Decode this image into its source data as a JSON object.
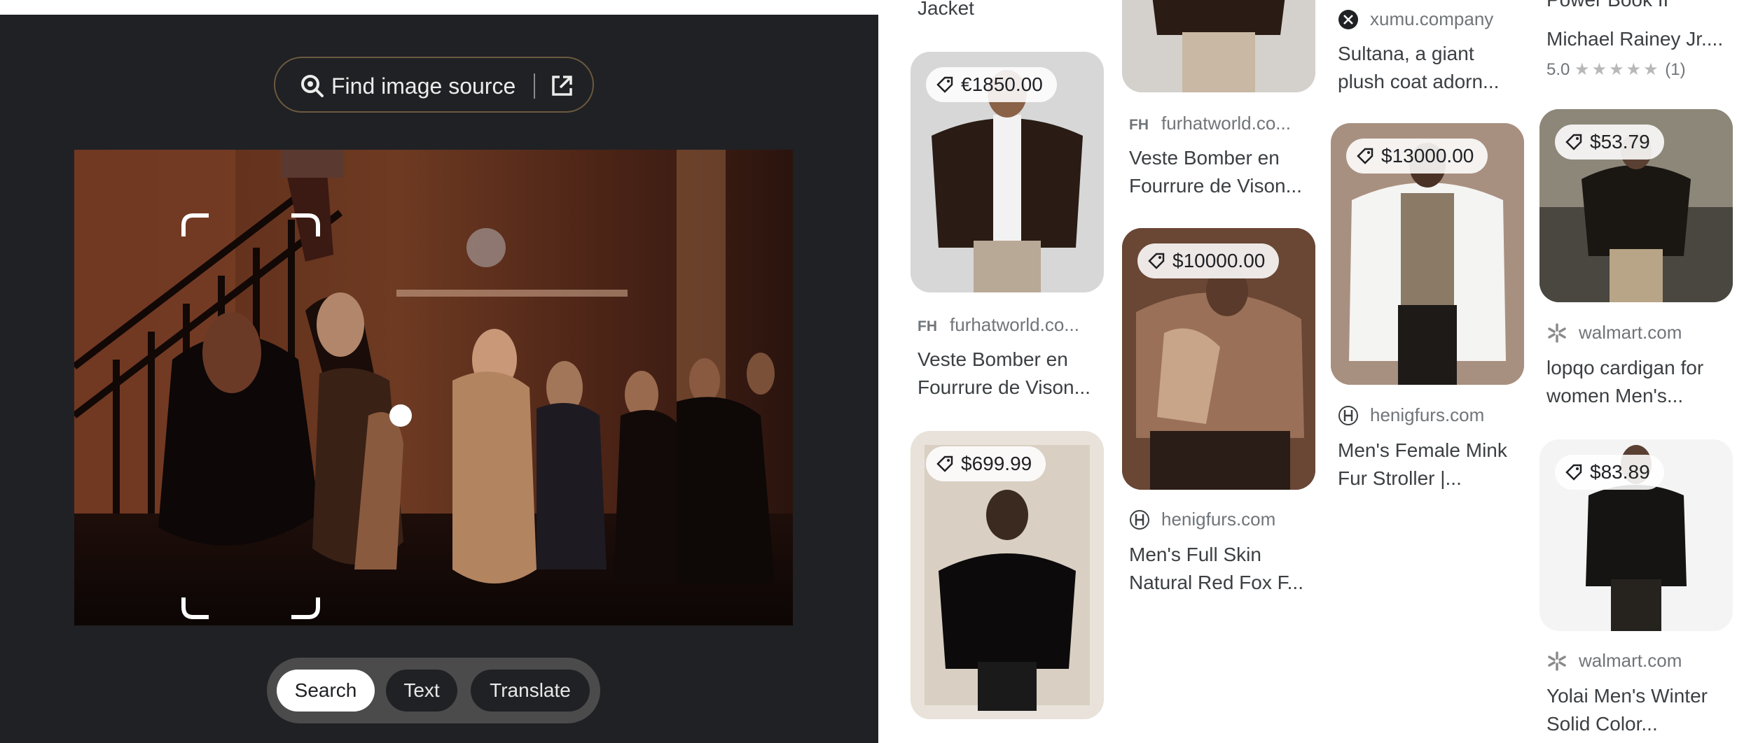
{
  "left_panel": {
    "find_source_label": "Find image source",
    "tabs": [
      "Search",
      "Text",
      "Translate"
    ],
    "active_tab": "Search"
  },
  "results": {
    "col1": [
      {
        "title_line2": "Jacket"
      },
      {
        "price": "€1850.00",
        "site": "furhatworld.co...",
        "title": [
          "Veste Bomber en",
          "Fourrure de Vison..."
        ]
      },
      {
        "price": "$699.99"
      }
    ],
    "col2": [
      {
        "site": "furhatworld.co...",
        "title": [
          "Veste Bomber en",
          "Fourrure de Vison..."
        ]
      },
      {
        "price": "$10000.00",
        "site": "henigfurs.com",
        "title": [
          "Men's Full Skin",
          "Natural Red Fox F..."
        ]
      }
    ],
    "col3": [
      {
        "site": "xumu.company",
        "title": [
          "Sultana, a giant",
          "plush coat adorn..."
        ]
      },
      {
        "price": "$13000.00",
        "site": "henigfurs.com",
        "title": [
          "Men's Female Mink",
          "Fur Stroller |..."
        ]
      }
    ],
    "col4": [
      {
        "title": [
          "Power Book II",
          "Michael Rainey Jr...."
        ],
        "rating": "5.0",
        "stars": "★★★★★",
        "count": "(1)"
      },
      {
        "price": "$53.79",
        "site": "walmart.com",
        "title": [
          "lopqo cardigan for",
          "women Men's..."
        ]
      },
      {
        "price": "$83.89",
        "site": "walmart.com",
        "title": [
          "Yolai Men's Winter",
          "Solid Color..."
        ]
      }
    ]
  },
  "colors": {
    "dark_bg": "#202124",
    "outline_brown": "#6b5a3f",
    "tab_bar": "#4b4b4b",
    "walmart_spark": "#8a8a8a"
  },
  "icons": [
    "lens-search-icon",
    "external-link-icon",
    "price-tag-icon",
    "fh-logo-icon",
    "henig-logo-icon",
    "xumu-logo-icon",
    "walmart-spark-icon"
  ]
}
